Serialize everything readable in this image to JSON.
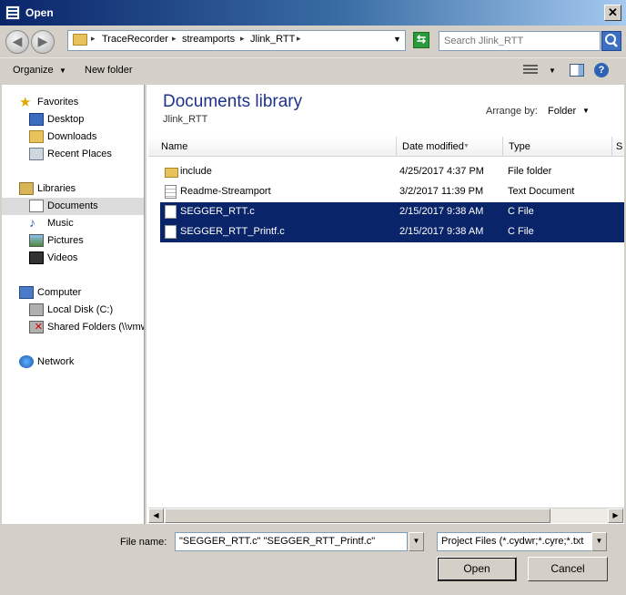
{
  "window": {
    "title": "Open"
  },
  "address": {
    "crumbs": [
      "TraceRecorder",
      "streamports",
      "Jlink_RTT"
    ],
    "search_placeholder": "Search Jlink_RTT"
  },
  "toolbar": {
    "organize": "Organize",
    "new_folder": "New folder"
  },
  "nav": {
    "favorites": "Favorites",
    "desktop": "Desktop",
    "downloads": "Downloads",
    "recent": "Recent Places",
    "libraries": "Libraries",
    "documents": "Documents",
    "music": "Music",
    "pictures": "Pictures",
    "videos": "Videos",
    "computer": "Computer",
    "local_disk": "Local Disk (C:)",
    "shared": "Shared Folders (\\\\vmw",
    "network": "Network"
  },
  "library": {
    "title": "Documents library",
    "subtitle": "Jlink_RTT",
    "arrange_label": "Arrange by:",
    "arrange_value": "Folder"
  },
  "columns": {
    "name": "Name",
    "date": "Date modified",
    "type": "Type",
    "size": "S"
  },
  "files": [
    {
      "name": "include",
      "date": "4/25/2017 4:37 PM",
      "type": "File folder",
      "icon": "folder-icon",
      "selected": false
    },
    {
      "name": "Readme-Streamport",
      "date": "3/2/2017 11:39 PM",
      "type": "Text Document",
      "icon": "text-document-icon",
      "selected": false
    },
    {
      "name": "SEGGER_RTT.c",
      "date": "2/15/2017 9:38 AM",
      "type": "C File",
      "icon": "c-file-icon",
      "selected": true
    },
    {
      "name": "SEGGER_RTT_Printf.c",
      "date": "2/15/2017 9:38 AM",
      "type": "C File",
      "icon": "c-file-icon",
      "selected": true
    }
  ],
  "bottom": {
    "filename_label": "File name:",
    "filename_value": "\"SEGGER_RTT.c\" \"SEGGER_RTT_Printf.c\"",
    "filetype_value": "Project Files (*.cydwr;*.cyre;*.txt",
    "open": "Open",
    "cancel": "Cancel"
  },
  "colors": {
    "selection": "#0a246a",
    "library_title": "#1e3287"
  }
}
